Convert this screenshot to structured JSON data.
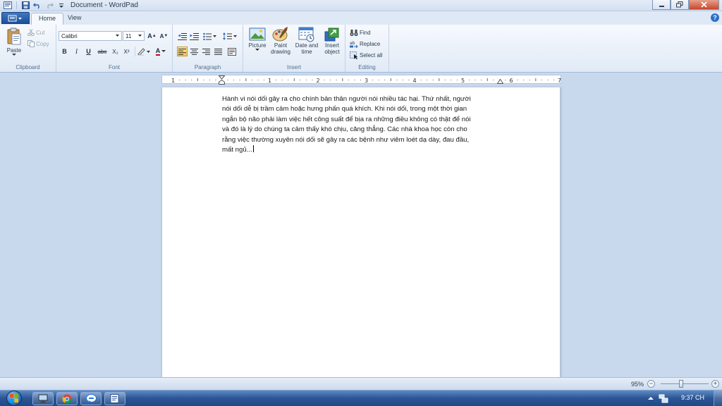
{
  "window": {
    "title": "Document - WordPad"
  },
  "tabs": {
    "home": "Home",
    "view": "View"
  },
  "clipboard": {
    "group_label": "Clipboard",
    "paste": "Paste",
    "cut": "Cut",
    "copy": "Copy"
  },
  "font": {
    "group_label": "Font",
    "family": "Calibri",
    "size": "11",
    "bold": "B",
    "italic": "I",
    "underline": "U",
    "strike": "abc",
    "subscript": "X₂",
    "superscript": "X²",
    "grow": "A",
    "shrink": "A",
    "font_color": "A"
  },
  "paragraph": {
    "group_label": "Paragraph"
  },
  "insert": {
    "group_label": "Insert",
    "picture": "Picture",
    "paint_drawing_1": "Paint",
    "paint_drawing_2": "drawing",
    "date_time_1": "Date and",
    "date_time_2": "time",
    "insert_object_1": "Insert",
    "insert_object_2": "object"
  },
  "editing": {
    "group_label": "Editing",
    "find": "Find",
    "replace": "Replace",
    "select_all": "Select all"
  },
  "ruler": {
    "labels": [
      "1",
      "1",
      "2",
      "3",
      "4",
      "5",
      "6",
      "7"
    ]
  },
  "document": {
    "lines": [
      "Hành vi nói dối gây ra cho chính bản thân người nói nhiều tác hại. Thứ nhất, người",
      "nói dối dễ bị trầm cảm hoặc hưng phấn quá khích. Khi nói dối, trong một thời gian",
      "ngắn bộ não phải làm việc hết công suất để bịa ra những điều không có thật để nói",
      "và đó là lý do chúng ta cảm thấy khó chịu, căng thẳng. Các nhà khoa học còn cho",
      "rằng việc thường xuyên nói dối sẽ gây ra các bệnh như viêm loét dạ dày, đau đầu,",
      "mất ngủ..."
    ]
  },
  "status": {
    "zoom": "95%",
    "zoom_out": "−",
    "zoom_in": "+"
  },
  "taskbar": {
    "clock": "9:37 CH"
  },
  "colors": {
    "accent": "#2b5594",
    "ribbon": "#e0eaf6",
    "highlight": "#f9c545"
  }
}
